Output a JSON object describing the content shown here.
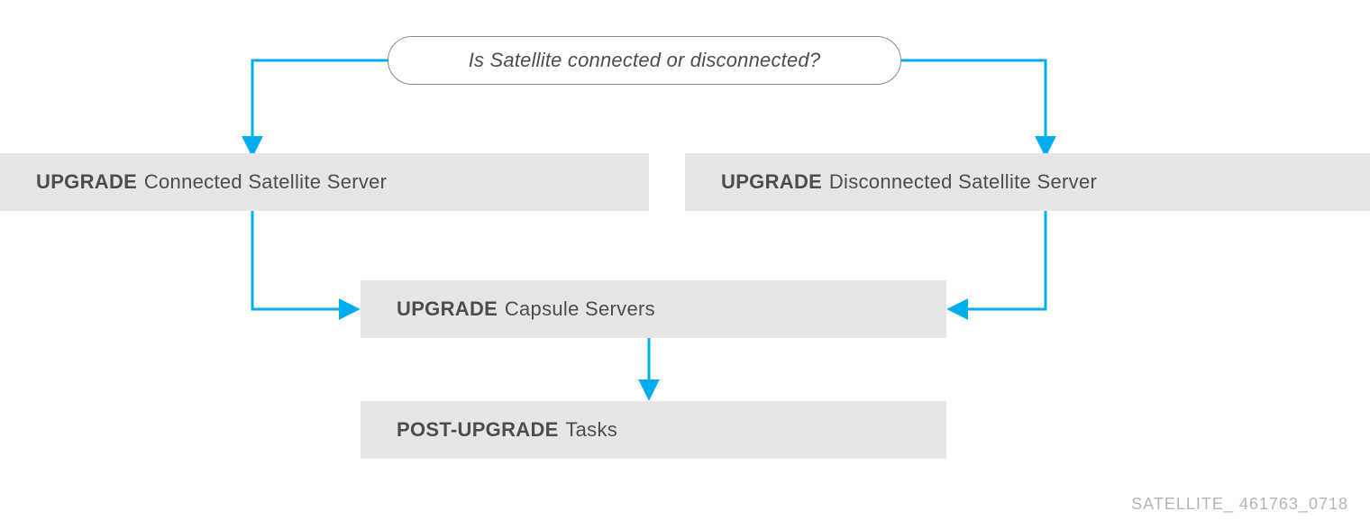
{
  "colors": {
    "arrow": "#00aeef",
    "box_bg": "#e6e6e6",
    "text": "#4d4d4d",
    "decision_border": "#8a8a8a",
    "footer": "#b5b5b5"
  },
  "decision": {
    "text": "Is Satellite connected or disconnected?"
  },
  "steps": {
    "connected": {
      "bold": "UPGRADE",
      "rest": "Connected Satellite Server"
    },
    "disconnected": {
      "bold": "UPGRADE",
      "rest": "Disconnected Satellite Server"
    },
    "capsule": {
      "bold": "UPGRADE",
      "rest": "Capsule Servers"
    },
    "post": {
      "bold": "POST-UPGRADE",
      "rest": "Tasks"
    }
  },
  "footer": "SATELLITE_ 461763_0718"
}
